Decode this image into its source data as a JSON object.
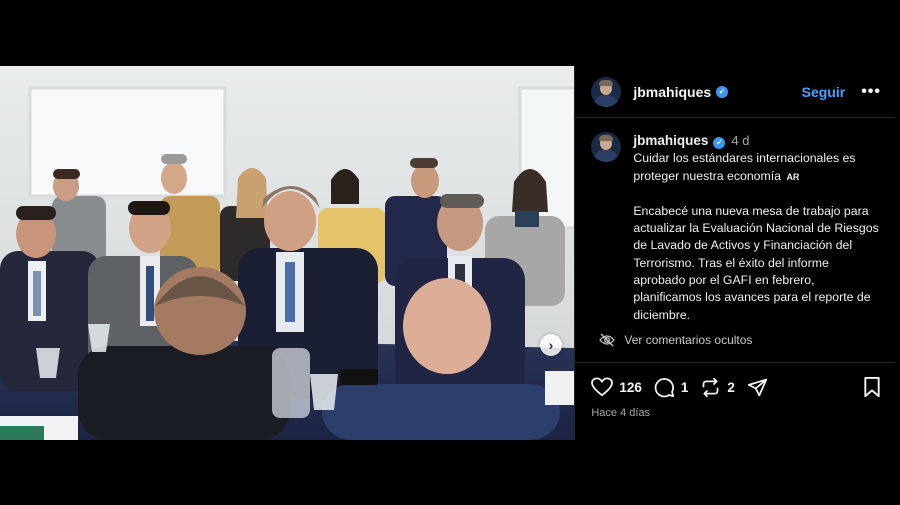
{
  "header": {
    "username": "jbmahiques",
    "follow_label": "Seguir",
    "more_label": "•••"
  },
  "caption": {
    "username": "jbmahiques",
    "time_ago": "4 d",
    "line1": "Cuidar los estándares internacionales es proteger nuestra economía",
    "flag": "AR",
    "line2": "Encabecé una nueva mesa de trabajo para actualizar la Evaluación Nacional de Riesgos de Lavado de Activos y Financiación del Terrorismo. Tras el éxito del informe aprobado por el GAFI en febrero, planificamos los avances para el reporte de diciembre."
  },
  "hidden_comments_label": "Ver comentarios ocultos",
  "actions": {
    "likes": "126",
    "comments": "1",
    "reposts": "2"
  },
  "timestamp": "Hace 4 días",
  "colors": {
    "accent": "#4aa3ff",
    "verified": "#3897f0",
    "background": "#000000"
  },
  "icons": [
    "verified-icon",
    "more-icon",
    "eye-off-icon",
    "heart-icon",
    "comment-icon",
    "repost-icon",
    "share-icon",
    "bookmark-icon",
    "chevron-right-icon"
  ]
}
